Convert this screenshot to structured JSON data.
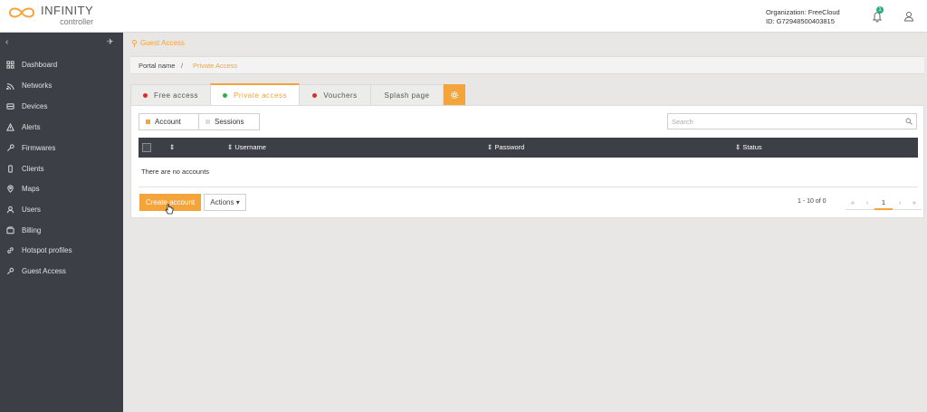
{
  "app": {
    "logo_title": "INFINITY",
    "logo_subtitle": "controller"
  },
  "header": {
    "organization": "Organization: FreeCloud",
    "org_id": "ID: G72948500403815",
    "notification_count": "1",
    "accent_color": "#f3a43b"
  },
  "sidebar": {
    "items": [
      {
        "label": "Dashboard",
        "icon": "grid-icon"
      },
      {
        "label": "Networks",
        "icon": "wifi-icon"
      },
      {
        "label": "Devices",
        "icon": "device-icon"
      },
      {
        "label": "Alerts",
        "icon": "warning-icon"
      },
      {
        "label": "Firmwares",
        "icon": "wrench-icon"
      },
      {
        "label": "Clients",
        "icon": "phone-icon"
      },
      {
        "label": "Maps",
        "icon": "map-pin-icon"
      },
      {
        "label": "Users",
        "icon": "users-icon"
      },
      {
        "label": "Billing",
        "icon": "billing-icon"
      },
      {
        "label": "Hotspot profiles",
        "icon": "link-icon"
      },
      {
        "label": "Guest Access",
        "icon": "key-icon"
      }
    ]
  },
  "page": {
    "section_title": "Guest Access",
    "breadcrumb": {
      "parent": "Portal name",
      "separator": "/",
      "current": "Private Access"
    }
  },
  "tabs": [
    {
      "label": "Free access",
      "dot_color": "#e02b27"
    },
    {
      "label": "Private access",
      "dot_color": "#2ab04a"
    },
    {
      "label": "Vouchers",
      "dot_color": "#e02b27"
    },
    {
      "label": "Splash page"
    }
  ],
  "toggle": {
    "account": "Account",
    "sessions": "Sessions"
  },
  "search": {
    "placeholder": "Search"
  },
  "table": {
    "columns": [
      "",
      "Username",
      "Password",
      "Status"
    ],
    "empty_message": "There are no accounts"
  },
  "footer": {
    "create_label": "Create account",
    "actions_label": "Actions ▾",
    "range": "1 - 10 of 0",
    "pagination": [
      "«",
      "‹",
      "1",
      "›",
      "»"
    ]
  }
}
